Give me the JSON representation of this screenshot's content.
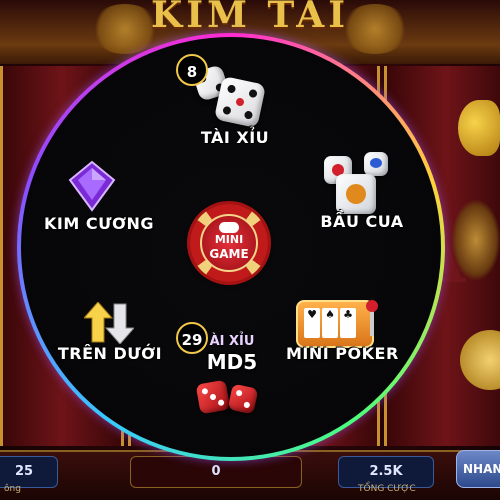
{
  "background": {
    "title": "KIM TÀI",
    "bottom_left_value": "25",
    "bottom_left_label": "ông",
    "bottom_center_value": "0",
    "bottom_right_value": "2.5K",
    "bottom_right_label": "TỔNG CƯỢC",
    "spin_button": "NHAN"
  },
  "menu": {
    "center_button": {
      "line1": "MINI",
      "line2": "GAME"
    },
    "games": {
      "tai_xiu": {
        "label": "TÀI XỈU",
        "badge": "8"
      },
      "kim_cuong": {
        "label": "KIM CƯƠNG"
      },
      "bau_cua": {
        "label": "BẦU CUA"
      },
      "tren_duoi": {
        "label": "TRÊN DƯỚI"
      },
      "tai_xiu_md5": {
        "line1": "ÀI XỈU",
        "line2": "MD5",
        "badge": "29"
      },
      "mini_poker": {
        "label": "MINI POKER"
      }
    }
  },
  "colors": {
    "ring_gradient": [
      "#ff2bd2",
      "#ffd23a",
      "#4dff7a",
      "#38c9ff",
      "#8a4dff"
    ],
    "badge_border": "#f1c84a",
    "chip_red": "#c01a1a"
  }
}
